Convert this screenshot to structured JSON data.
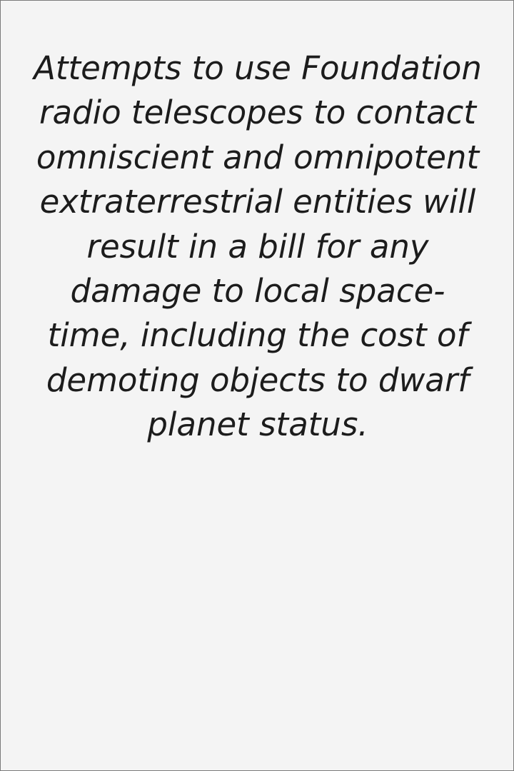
{
  "card": {
    "message": "Attempts to use Foundation radio telescopes to contact omniscient and omnipotent extraterrestrial entities will result in a bill for any damage to local space-time, including the cost of demoting objects to dwarf planet status."
  },
  "colors": {
    "background": "#f4f4f4",
    "text": "#1c1c1c",
    "border": "#7a7a7a"
  }
}
